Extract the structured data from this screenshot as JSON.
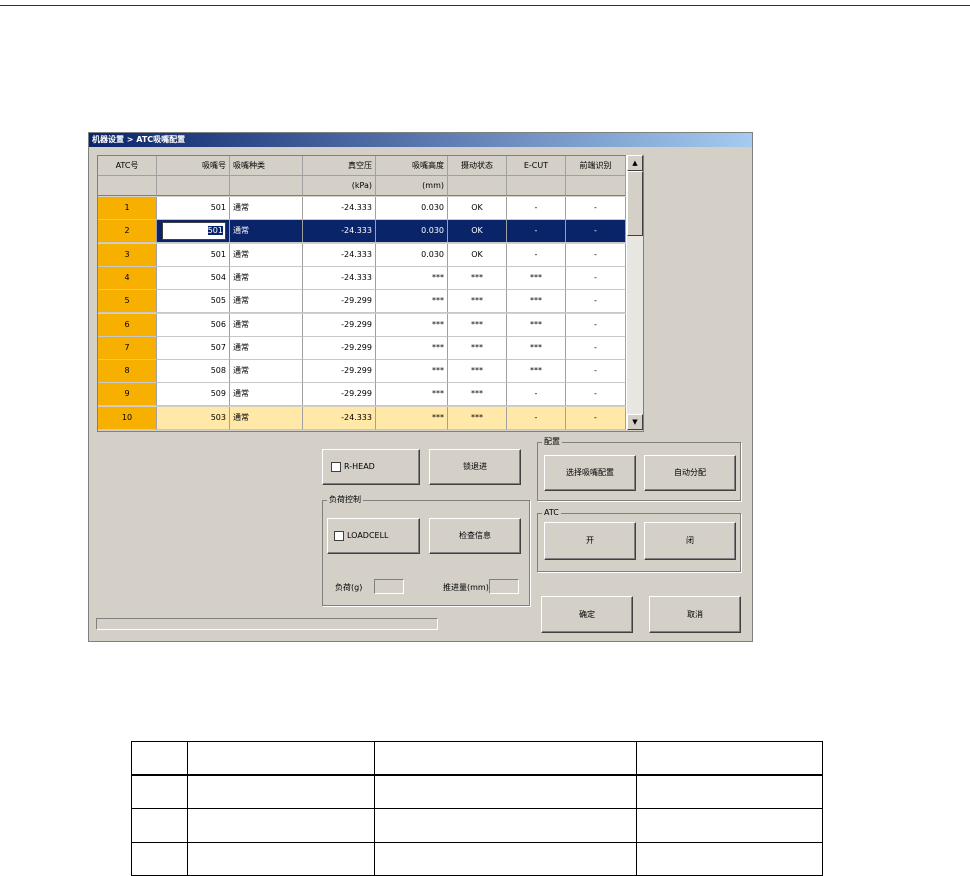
{
  "window": {
    "title": "机器设置 > ATC吸嘴配置"
  },
  "grid": {
    "headers": [
      "ATC号",
      "吸嘴号",
      "吸嘴种类",
      "真空压",
      "吸嘴高度",
      "摄动状态",
      "E-CUT",
      "前端识别"
    ],
    "units": [
      "",
      "",
      "",
      "(kPa)",
      "(mm)",
      "",
      "",
      ""
    ],
    "rows": [
      [
        "1",
        "501",
        "通常",
        "-24.333",
        "0.030",
        "OK",
        "-",
        "-"
      ],
      [
        "2",
        "501",
        "通常",
        "-24.333",
        "0.030",
        "OK",
        "-",
        "-"
      ],
      [
        "3",
        "501",
        "通常",
        "-24.333",
        "0.030",
        "OK",
        "-",
        "-"
      ],
      [
        "4",
        "504",
        "通常",
        "-24.333",
        "***",
        "***",
        "***",
        "-"
      ],
      [
        "5",
        "505",
        "通常",
        "-29.299",
        "***",
        "***",
        "***",
        "-"
      ],
      [
        "6",
        "506",
        "通常",
        "-29.299",
        "***",
        "***",
        "***",
        "-"
      ],
      [
        "7",
        "507",
        "通常",
        "-29.299",
        "***",
        "***",
        "***",
        "-"
      ],
      [
        "8",
        "508",
        "通常",
        "-29.299",
        "***",
        "***",
        "***",
        "-"
      ],
      [
        "9",
        "509",
        "通常",
        "-29.299",
        "***",
        "***",
        "-",
        "-"
      ],
      [
        "10",
        "503",
        "通常",
        "-24.333",
        "***",
        "***",
        "-",
        "-"
      ]
    ],
    "selected_row": 2,
    "highlight_row": 10,
    "scroll_up_glyph": "▲",
    "scroll_down_glyph": "▼"
  },
  "controls": {
    "rhead_label": "R-HEAD",
    "retract_label": "锁退进",
    "load_group": "负荷控制",
    "loadcell_label": "LOADCELL",
    "check_info_label": "检查信息",
    "load_label": "负荷(g)",
    "advance_label": "推进量(mm)",
    "config_group": "配置",
    "select_config_label": "选择吸嘴配置",
    "auto_assign_label": "自动分配",
    "atc_group": "ATC",
    "open_label": "开",
    "close_label": "闭",
    "ok_label": "确定",
    "cancel_label": "取消"
  },
  "colors": {
    "atc_orange": "#f8b000",
    "selection": "#0a246a",
    "highlight": "#ffe8a8"
  }
}
